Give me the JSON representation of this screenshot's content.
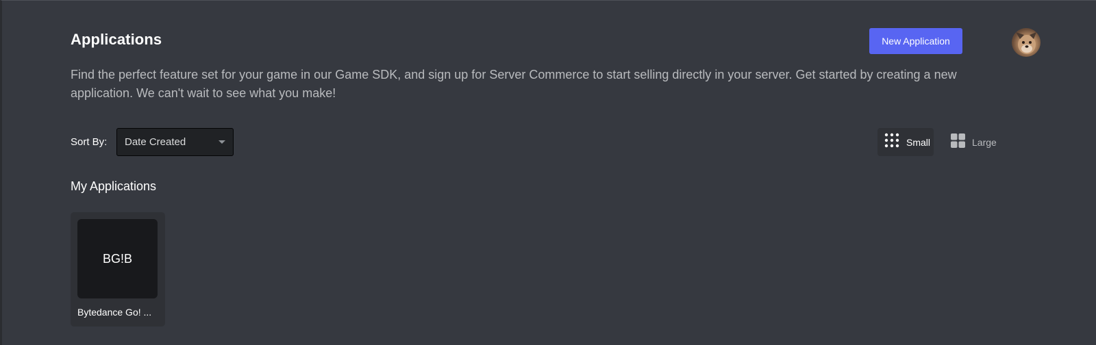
{
  "header": {
    "title": "Applications",
    "new_button_label": "New Application"
  },
  "description": "Find the perfect feature set for your game in our Game SDK, and sign up for Server Commerce to start selling directly in your server. Get started by creating a new application. We can't wait to see what you make!",
  "sort": {
    "label": "Sort By:",
    "selected": "Date Created"
  },
  "view_toggle": {
    "small_label": "Small",
    "large_label": "Large",
    "active": "Small"
  },
  "section_title": "My Applications",
  "applications": [
    {
      "icon_text": "BG!B",
      "name": "Bytedance Go! ..."
    }
  ],
  "colors": {
    "background": "#36393f",
    "accent": "#5865f2",
    "card": "#2f3136",
    "icon_bg": "#18191c",
    "muted_text": "#b9bbbe"
  }
}
